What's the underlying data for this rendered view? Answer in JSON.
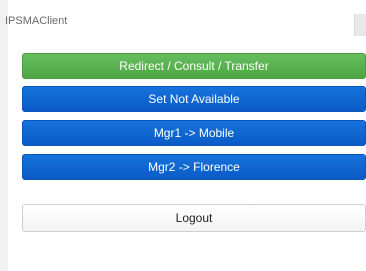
{
  "app": {
    "title": "IPSMAClient"
  },
  "actions": {
    "redirect_label": "Redirect / Consult / Transfer",
    "set_not_available_label": "Set Not Available",
    "mgr1_label": "Mgr1 -> Mobile",
    "mgr2_label": "Mgr2 -> Florence",
    "logout_label": "Logout"
  },
  "colors": {
    "green_button": "#5cb85c",
    "blue_button": "#0f66d0",
    "logout_button": "#ffffff"
  }
}
